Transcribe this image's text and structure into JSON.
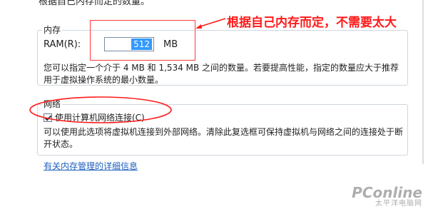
{
  "header": {
    "cut_text": "根据自己内存而定的数量。"
  },
  "memory": {
    "group_title": "内存",
    "ram_label": "RAM(R):",
    "ram_value": "512",
    "unit": "MB",
    "description": "您可以指定一个介于 4 MB 和 1,534 MB 之间的数量。若要提高性能，指定的数量应大于推荐用于虚拟操作系统的最小数量。"
  },
  "network": {
    "group_title": "网络",
    "checkbox_label": "使用计算机网络连接(C)",
    "checked": true,
    "description": "可以使用此选项将虚拟机连接到外部网络。清除此复选框可保持虚拟机与网络之间的连接处于断开状态。"
  },
  "links": {
    "memory_help": "有关内存管理的详细信息"
  },
  "annotation": {
    "text": "根据自己内存而定，不需要太大",
    "color": "#ff1a1a"
  },
  "watermark": {
    "brand": "PConline",
    "sub": "太平洋电脑网"
  }
}
